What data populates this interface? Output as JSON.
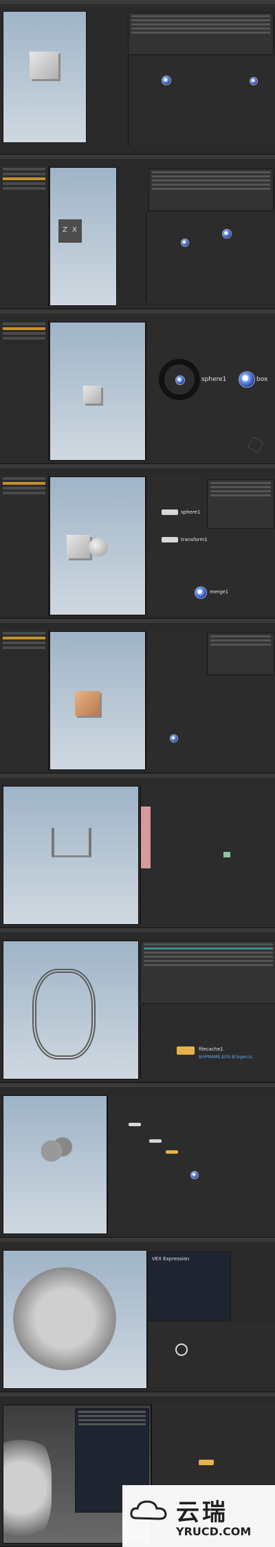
{
  "frames": [
    {
      "id": 1,
      "caption": "Box object in viewport, simple network"
    },
    {
      "id": 2,
      "caption": "Box with axis gizmo"
    },
    {
      "id": 3,
      "caption": "Radial menu in network editor"
    },
    {
      "id": 4,
      "caption": "Sphere and transform nodes merged"
    },
    {
      "id": 5,
      "caption": "Box with sphere, node network"
    },
    {
      "id": 6,
      "caption": "Stairs profile geometry"
    },
    {
      "id": 7,
      "caption": "Spiral staircase with filecache"
    },
    {
      "id": 8,
      "caption": "Fractured pieces with large network"
    },
    {
      "id": 9,
      "caption": "Dense fracture cloud with VEX wrangle editor"
    },
    {
      "id": 10,
      "caption": "Fracture pieces with VEX editor overlay"
    }
  ],
  "nodes": {
    "sphere1": "sphere1",
    "box": "box",
    "transform1": "transform1",
    "merge1": "merge1",
    "filecache1": "filecache1",
    "filecache_path": "$HIPNAME.$OS.$F.bgeo.sc"
  },
  "axis_labels": {
    "z": "Z",
    "x": "X"
  },
  "vex_title": "VEX Expression",
  "watermark": {
    "cn": "云瑞",
    "en": "YRUCD.COM"
  }
}
